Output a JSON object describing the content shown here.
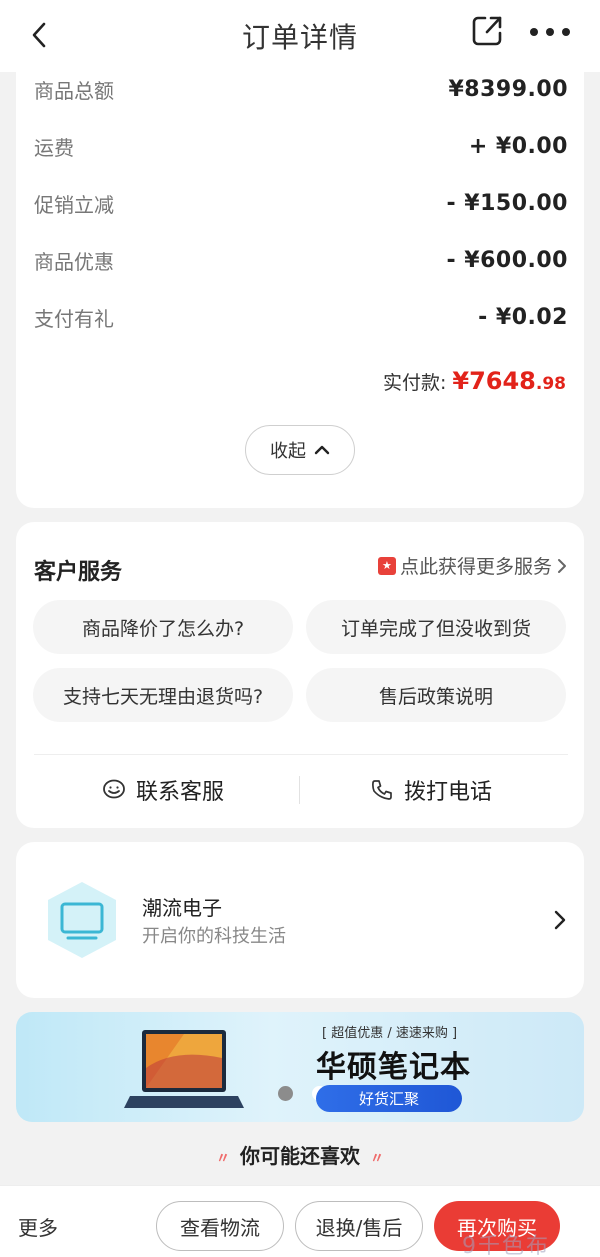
{
  "header": {
    "title": "订单详情"
  },
  "price": {
    "rows": [
      {
        "label": "商品总额",
        "value": "¥8399.00"
      },
      {
        "label": "运费",
        "value": "+ ¥0.00"
      },
      {
        "label": "促销立减",
        "value": "- ¥150.00"
      },
      {
        "label": "商品优惠",
        "value": "- ¥600.00"
      },
      {
        "label": "支付有礼",
        "value": "- ¥0.02"
      }
    ],
    "paid_label": "实付款:",
    "paid_int": "¥7648",
    "paid_dec": ".98",
    "collapse_label": "收起"
  },
  "service": {
    "title": "客户服务",
    "link": "点此获得更多服务",
    "questions": [
      "商品降价了怎么办?",
      "订单完成了但没收到货",
      "支持七天无理由退货吗?",
      "售后政策说明"
    ],
    "contact_label": "联系客服",
    "call_label": "拨打电话"
  },
  "shop": {
    "name": "潮流电子",
    "slogan": "开启你的科技生活"
  },
  "banner": {
    "tag": "[ 超值优惠 / 速速来购 ]",
    "headline": "华硕笔记本",
    "button": "好货汇聚"
  },
  "recommend": {
    "title": "你可能还喜欢"
  },
  "bottom": {
    "more": "更多",
    "logistics": "查看物流",
    "return": "退换/售后",
    "rebuy": "再次购买"
  },
  "watermark": "9千色布",
  "colors": {
    "accent": "#e2231a",
    "primary_button": "#ea3c35"
  }
}
